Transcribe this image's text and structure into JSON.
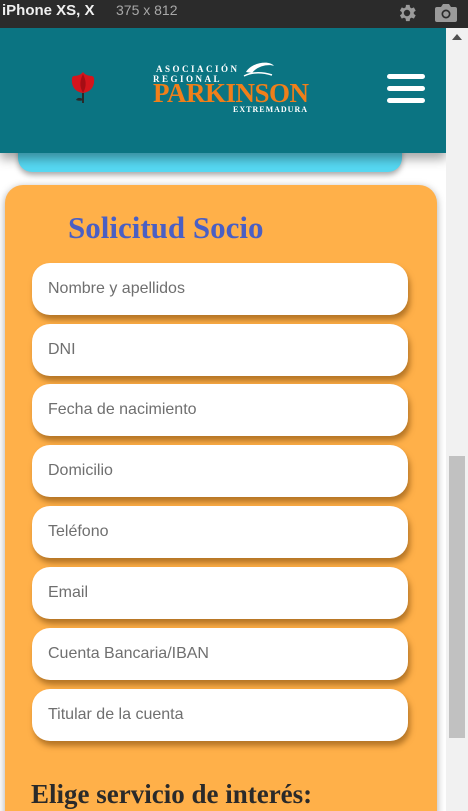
{
  "devtools": {
    "device_name": "iPhone XS, X",
    "dimensions": "375  x  812",
    "icons": [
      "gear-icon",
      "camera-icon"
    ]
  },
  "header": {
    "logo": {
      "line1": "ASOCIACIÓN",
      "line2": "REGIONAL",
      "line3": "PARKINSON",
      "line4": "EXTREMADURA"
    },
    "menu_icon": "hamburger-menu-icon",
    "tulip_icon": "tulip-icon"
  },
  "form": {
    "title": "Solicitud Socio",
    "fields": [
      {
        "placeholder": "Nombre y apellidos"
      },
      {
        "placeholder": "DNI"
      },
      {
        "placeholder": "Fecha de nacimiento"
      },
      {
        "placeholder": "Domicilio"
      },
      {
        "placeholder": "Teléfono"
      },
      {
        "placeholder": "Email"
      },
      {
        "placeholder": "Cuenta Bancaria/IBAN"
      },
      {
        "placeholder": "Titular de la cuenta"
      }
    ],
    "services_heading": "Elige servicio de interés:"
  },
  "colors": {
    "header_bg": "#0b7482",
    "logo_orange": "#f07f1a",
    "form_bg": "#ffb049",
    "title_blue": "#4a5fc4",
    "cyan_card": "#56d8f2"
  }
}
